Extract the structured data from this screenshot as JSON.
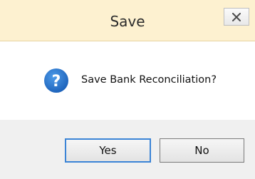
{
  "window": {
    "title": "Save"
  },
  "message": {
    "text": "Save Bank Reconciliation?",
    "icon": "question-icon"
  },
  "buttons": {
    "yes_label": "Yes",
    "no_label": "No"
  },
  "colors": {
    "titlebar_bg": "#fdf1d0",
    "icon_blue": "#1f6fc6",
    "focus_border": "#3b84d6"
  }
}
